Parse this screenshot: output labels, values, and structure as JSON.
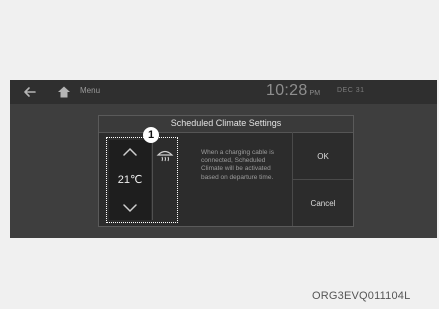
{
  "topbar": {
    "back_icon": "back-arrow-icon",
    "home_icon": "home-icon",
    "menu_label": "Menu",
    "time": "10:28",
    "ampm": "PM",
    "date": "DEC 31"
  },
  "dialog": {
    "title": "Scheduled Climate Settings",
    "temperature": "21℃",
    "temp_up_icon": "chevron-up-icon",
    "temp_down_icon": "chevron-down-icon",
    "defrost_icon": "front-defrost-icon",
    "callout_number": "1",
    "info_text": "When a charging cable is connected, Scheduled Climate will be activated based on departure time.",
    "ok_label": "OK",
    "cancel_label": "Cancel"
  },
  "image_code": "ORG3EVQ011104L",
  "colors": {
    "screen_bg": "#3e3e3e",
    "topbar_bg": "#2f2f2f",
    "dialog_bg": "#2c2c2c",
    "text_light": "#e2e2e2",
    "highlight": "#ffffff"
  }
}
